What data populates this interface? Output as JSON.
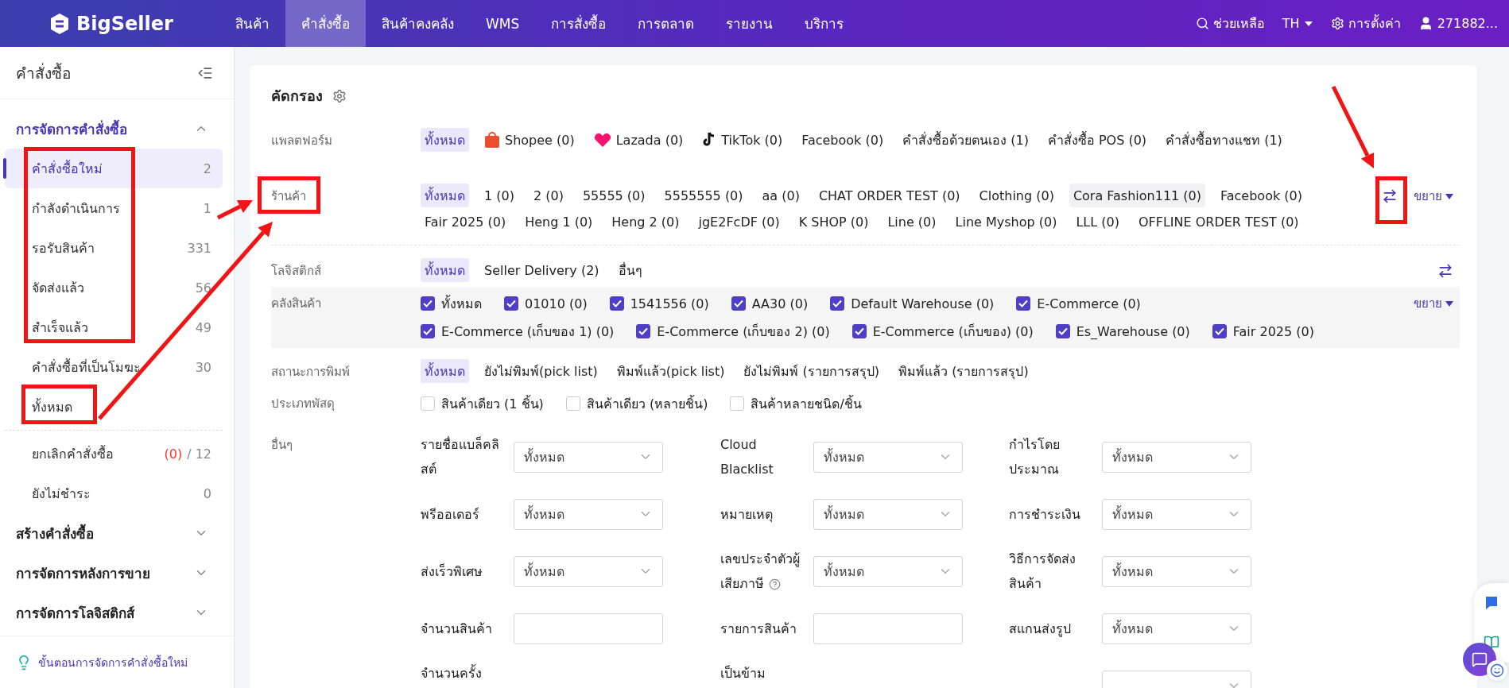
{
  "nav": {
    "logo": "BigSeller",
    "items": [
      {
        "label": "สินค้า",
        "selected": false
      },
      {
        "label": "คำสั่งซื้อ",
        "selected": true
      },
      {
        "label": "สินค้าคงคลัง",
        "selected": false
      },
      {
        "label": "WMS",
        "selected": false
      },
      {
        "label": "การสั่งซื้อ",
        "selected": false
      },
      {
        "label": "การตลาด",
        "selected": false
      },
      {
        "label": "รายงาน",
        "selected": false
      },
      {
        "label": "บริการ",
        "selected": false
      }
    ],
    "help": "ช่วยเหลือ",
    "language": "TH",
    "settings": "การตั้งค่า",
    "user": "271882..."
  },
  "sidebar": {
    "title": "คำสั่งซื้อ",
    "groups": [
      {
        "title": "การจัดการคำสั่งซื้อ",
        "expanded": true,
        "items": [
          {
            "label": "คำสั่งซื้อใหม่",
            "count": "2",
            "selected": true
          },
          {
            "label": "กำลังดำเนินการ",
            "count": "1",
            "selected": false
          },
          {
            "label": "รอรับสินค้า",
            "count": "331",
            "selected": false
          },
          {
            "label": "จัดส่งแล้ว",
            "count": "56",
            "selected": false
          },
          {
            "label": "สำเร็จแล้ว",
            "count": "49",
            "selected": false
          },
          {
            "label": "คำสั่งซื้อที่เป็นโมฆะ",
            "count": "30",
            "selected": false
          },
          {
            "label": "ทั้งหมด",
            "selected": false
          }
        ],
        "secondary_items": [
          {
            "label": "ยกเลิกคำสั่งซื้อ",
            "alert_count": "(0)",
            "count": "/ 12",
            "selected": false
          },
          {
            "label": "ยังไม่ชำระ",
            "count": "0",
            "selected": false
          }
        ]
      },
      {
        "title": "สร้างคำสั่งซื้อ",
        "expanded": false
      },
      {
        "title": "การจัดการหลังการขาย",
        "expanded": false
      },
      {
        "title": "การจัดการโลจิสติกส์",
        "expanded": false
      }
    ],
    "footer": "ขั้นตอนการจัดการคำสั่งซื้อใหม่"
  },
  "filter": {
    "title": "คัดกรอง",
    "platform": {
      "label": "แพลตฟอร์ม",
      "options": [
        {
          "label": "ทั้งหมด",
          "kind": "text",
          "selected": true
        },
        {
          "label": "Shopee (0)",
          "kind": "shopee",
          "selected": false
        },
        {
          "label": "Lazada (0)",
          "kind": "lazada",
          "selected": false
        },
        {
          "label": "TikTok (0)",
          "kind": "tiktok",
          "selected": false
        },
        {
          "label": "Facebook (0)",
          "kind": "text",
          "selected": false
        },
        {
          "label": "คำสั่งซื้อด้วยตนเอง (1)",
          "kind": "text",
          "selected": false
        },
        {
          "label": "คำสั่งซื้อ POS (0)",
          "kind": "text",
          "selected": false
        },
        {
          "label": "คำสั่งซื้อทางแชท (1)",
          "kind": "text",
          "selected": false
        }
      ]
    },
    "shop": {
      "label": "ร้านค้า",
      "expand": "ขยาย",
      "options": [
        {
          "label": "ทั้งหมด",
          "selected": true,
          "hovered": false
        },
        {
          "label": "1 (0)",
          "selected": false,
          "hovered": false
        },
        {
          "label": "2 (0)",
          "selected": false,
          "hovered": false
        },
        {
          "label": "55555 (0)",
          "selected": false,
          "hovered": false
        },
        {
          "label": "5555555 (0)",
          "selected": false,
          "hovered": false
        },
        {
          "label": "aa (0)",
          "selected": false,
          "hovered": false
        },
        {
          "label": "CHAT ORDER TEST (0)",
          "selected": false,
          "hovered": false
        },
        {
          "label": "Clothing (0)",
          "selected": false,
          "hovered": false
        },
        {
          "label": "Cora Fashion111 (0)",
          "selected": false,
          "hovered": true
        },
        {
          "label": "Facebook (0)",
          "selected": false,
          "hovered": false
        },
        {
          "label": "Fair 2025 (0)",
          "selected": false,
          "hovered": false
        },
        {
          "label": "Heng 1 (0)",
          "selected": false,
          "hovered": false
        },
        {
          "label": "Heng 2 (0)",
          "selected": false,
          "hovered": false
        },
        {
          "label": "jgE2FcDF (0)",
          "selected": false,
          "hovered": false
        },
        {
          "label": "K SHOP (0)",
          "selected": false,
          "hovered": false
        },
        {
          "label": "Line (0)",
          "selected": false,
          "hovered": false
        },
        {
          "label": "Line Myshop (0)",
          "selected": false,
          "hovered": false
        },
        {
          "label": "LLL (0)",
          "selected": false,
          "hovered": false
        },
        {
          "label": "OFFLINE ORDER TEST (0)",
          "selected": false,
          "hovered": false
        }
      ]
    },
    "logistics": {
      "label": "โลจิสติกส์",
      "options": [
        {
          "label": "ทั้งหมด",
          "selected": true
        },
        {
          "label": "Seller Delivery (2)",
          "selected": false
        },
        {
          "label": "อื่นๆ",
          "selected": false
        }
      ]
    },
    "warehouse": {
      "label": "คลังสินค้า",
      "expand": "ขยาย",
      "options": [
        {
          "label": "ทั้งหมด",
          "checked": true
        },
        {
          "label": "01010 (0)",
          "checked": true
        },
        {
          "label": "1541556 (0)",
          "checked": true
        },
        {
          "label": "AA30 (0)",
          "checked": true
        },
        {
          "label": "Default Warehouse (0)",
          "checked": true
        },
        {
          "label": "E-Commerce (0)",
          "checked": true
        },
        {
          "label": "E-Commerce (เก็บของ 1) (0)",
          "checked": true
        },
        {
          "label": "E-Commerce (เก็บของ 2) (0)",
          "checked": true
        },
        {
          "label": "E-Commerce (เก็บของ) (0)",
          "checked": true
        },
        {
          "label": "Es_Warehouse (0)",
          "checked": true
        },
        {
          "label": "Fair 2025 (0)",
          "checked": true
        }
      ]
    },
    "print_status": {
      "label": "สถานะการพิมพ์",
      "options": [
        {
          "label": "ทั้งหมด",
          "selected": true
        },
        {
          "label": "ยังไม่พิมพ์(pick list)",
          "selected": false
        },
        {
          "label": "พิมพ์แล้ว(pick list)",
          "selected": false
        },
        {
          "label": "ยังไม่พิมพ์ (รายการสรุป)",
          "selected": false
        },
        {
          "label": "พิมพ์แล้ว (รายการสรุป)",
          "selected": false
        }
      ]
    },
    "parcel_type": {
      "label": "ประเภทพัสดุ",
      "options": [
        {
          "label": "สินค้าเดียว (1 ชิ้น)",
          "checked": false
        },
        {
          "label": "สินค้าเดียว (หลายชิ้น)",
          "checked": false
        },
        {
          "label": "สินค้าหลายชนิด/ชิ้น",
          "checked": false
        }
      ]
    },
    "others": {
      "label": "อื่นๆ",
      "rows": [
        {
          "fields": [
            {
              "label": "รายชื่อแบล็คลิสต์",
              "kind": "select",
              "value": "ทั้งหมด"
            },
            {
              "label": "Cloud Blacklist",
              "kind": "select",
              "value": "ทั้งหมด"
            },
            {
              "label": "กำไรโดยประมาณ",
              "kind": "select",
              "value": "ทั้งหมด"
            }
          ]
        },
        {
          "fields": [
            {
              "label": "พรีออเดอร์",
              "kind": "select",
              "value": "ทั้งหมด"
            },
            {
              "label": "หมายเหตุ",
              "kind": "select",
              "value": "ทั้งหมด"
            },
            {
              "label": "การชำระเงิน",
              "kind": "select",
              "value": "ทั้งหมด"
            }
          ]
        },
        {
          "fields": [
            {
              "label": "ส่งเร็วพิเศษ",
              "kind": "select",
              "value": "ทั้งหมด"
            },
            {
              "label": "เลขประจำตัวผู้เสียภาษี",
              "kind": "select",
              "value": "ทั้งหมด",
              "help": true
            },
            {
              "label": "วิธีการจัดส่งสินค้า",
              "kind": "select",
              "value": "ทั้งหมด"
            }
          ]
        },
        {
          "fields": [
            {
              "label": "จำนวนสินค้า",
              "kind": "input"
            },
            {
              "label": "รายการสินค้า",
              "kind": "input"
            },
            {
              "label": "สแกนส่งรูป",
              "kind": "select",
              "value": "ทั้งหมด"
            }
          ]
        },
        {
          "fields": [
            {
              "label": "จำนวนครั้ง",
              "kind": "none"
            },
            {
              "label": "เป็นข้าม",
              "kind": "none"
            },
            {
              "kind": "select"
            }
          ]
        }
      ]
    }
  }
}
